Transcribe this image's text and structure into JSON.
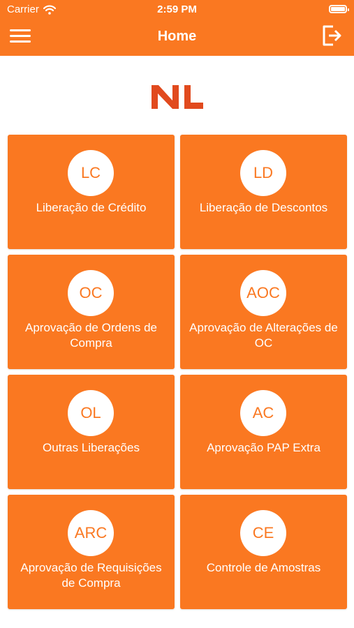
{
  "status_bar": {
    "carrier": "Carrier",
    "time": "2:59 PM"
  },
  "nav": {
    "title": "Home"
  },
  "logo": {
    "text": "NL",
    "color": "#e14a1e"
  },
  "colors": {
    "accent": "#fa7821"
  },
  "tiles": [
    {
      "abbr": "LC",
      "label": "Liberação de Crédito"
    },
    {
      "abbr": "LD",
      "label": "Liberação de Descontos"
    },
    {
      "abbr": "OC",
      "label": "Aprovação de Ordens de Compra"
    },
    {
      "abbr": "AOC",
      "label": "Aprovação de Alterações de OC"
    },
    {
      "abbr": "OL",
      "label": "Outras Liberações"
    },
    {
      "abbr": "AC",
      "label": "Aprovação PAP Extra"
    },
    {
      "abbr": "ARC",
      "label": "Aprovação de Requisições de Compra"
    },
    {
      "abbr": "CE",
      "label": "Controle de Amostras"
    }
  ]
}
